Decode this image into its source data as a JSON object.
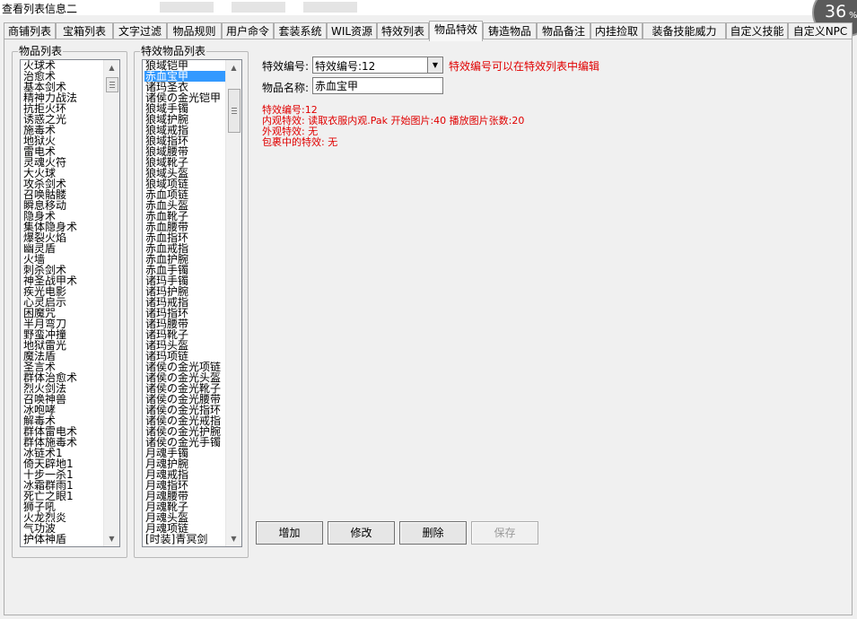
{
  "window": {
    "title": "查看列表信息二",
    "zoom_badge": {
      "value": "36",
      "unit": "%"
    }
  },
  "tabs": [
    "商铺列表",
    "宝箱列表",
    "文字过滤",
    "物品规则",
    "用户命令",
    "套装系统",
    "WIL资源",
    "特效列表",
    "物品特效",
    "铸造物品",
    "物品备注",
    "内挂捡取",
    "装备技能威力",
    "自定义技能",
    "自定义NPC"
  ],
  "active_tab": 8,
  "left_group": {
    "label": "物品列表",
    "items": [
      "火球术",
      "治愈术",
      "基本剑术",
      "精神力战法",
      "抗拒火环",
      "诱惑之光",
      "施毒术",
      "地狱火",
      "雷电术",
      "灵魂火符",
      "大火球",
      "攻杀剑术",
      "召唤骷髅",
      "瞬息移动",
      "隐身术",
      "集体隐身术",
      "爆裂火焰",
      "幽灵盾",
      "火墙",
      "刺杀剑术",
      "神圣战甲术",
      "疾光电影",
      "心灵启示",
      "困魔咒",
      "半月弯刀",
      "野蛮冲撞",
      "地狱雷光",
      "魔法盾",
      "圣言术",
      "群体治愈术",
      "烈火剑法",
      "召唤神兽",
      "冰咆哮",
      "解毒术",
      "群体雷电术",
      "群体施毒术",
      "冰链术1",
      "倚天辟地1",
      "十步一杀1",
      "冰霜群雨1",
      "死亡之眼1",
      "狮子吼",
      "火龙烈炎",
      "气功波",
      "护体神盾"
    ]
  },
  "right_group": {
    "label": "特效物品列表",
    "selected_index": 1,
    "items": [
      "狼域铠甲",
      "赤血宝甲",
      "诸玛圣衣",
      "诸侯の金光铠甲",
      "狼域手镯",
      "狼域护腕",
      "狼域戒指",
      "狼域指环",
      "狼域腰带",
      "狼域靴子",
      "狼域头盔",
      "狼域项链",
      "赤血项链",
      "赤血头盔",
      "赤血靴子",
      "赤血腰带",
      "赤血指环",
      "赤血戒指",
      "赤血护腕",
      "赤血手镯",
      "诸玛手镯",
      "诸玛护腕",
      "诸玛戒指",
      "诸玛指环",
      "诸玛腰带",
      "诸玛靴子",
      "诸玛头盔",
      "诸玛项链",
      "诸侯の金光项链",
      "诸侯の金光头盔",
      "诸侯の金光靴子",
      "诸侯の金光腰带",
      "诸侯の金光指环",
      "诸侯の金光戒指",
      "诸侯の金光护腕",
      "诸侯の金光手镯",
      "月魂手镯",
      "月魂护腕",
      "月魂戒指",
      "月魂指环",
      "月魂腰带",
      "月魂靴子",
      "月魂头盔",
      "月魂项链",
      "[时装]青冥剑"
    ]
  },
  "form": {
    "effect_id_label": "特效编号:",
    "effect_id_value": "特效编号:12",
    "effect_id_hint": "特效编号可以在特效列表中编辑",
    "item_name_label": "物品名称:",
    "item_name_value": "赤血宝甲"
  },
  "info_lines": [
    "特效编号:12",
    "内观特效: 读取衣服内观.Pak 开始图片:40 播放图片张数:20",
    "外观特效: 无",
    "包裹中的特效: 无"
  ],
  "buttons": {
    "add": "增加",
    "edit": "修改",
    "delete": "删除",
    "save": "保存"
  },
  "colors": {
    "selection": "#3399ff",
    "info_text": "#e00000"
  }
}
